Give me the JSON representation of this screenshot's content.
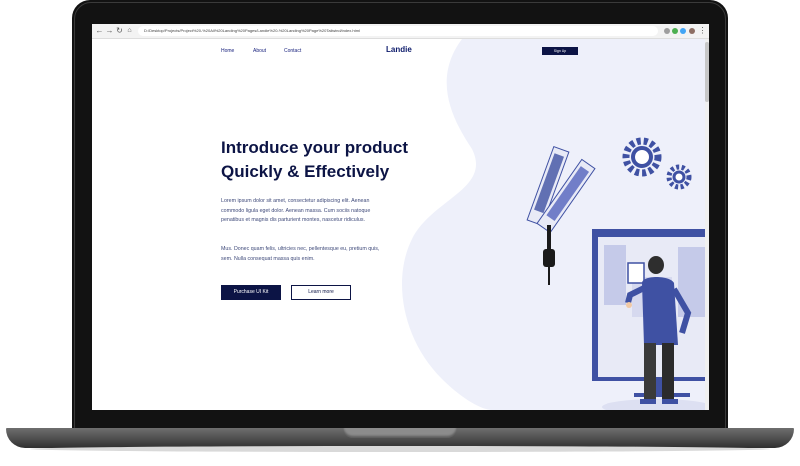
{
  "browser": {
    "url": "D:/Desktop/Projects/Project%20-%20All%20Landing%20Pages/Landie%20-%20Landing%20Page%20Tailwind/index.html"
  },
  "header": {
    "nav_links": [
      "Home",
      "About",
      "Contact"
    ],
    "logo": "Landie",
    "cta_label": "Sign Up"
  },
  "hero": {
    "title_line1": "Introduce your product",
    "title_line2": "Quickly & Effectively",
    "paragraph1": "Lorem ipsum dolor sit amet, consectetur adipiscing elit. Aenean commodo ligula eget dolor. Aenean massa. Cum sociis natoque penatibus et magnis dis parturient montes, nascetur ridiculus.",
    "paragraph2": "Mus. Donec quam felis, ultricies nec, pellentesque eu, pretium quis, sem. Nulla consequat massa quis enim.",
    "primary_button": "Purchase UI Kit",
    "secondary_button": "Learn more"
  },
  "colors": {
    "primary": "#0c1445",
    "accent": "#3f51a3",
    "blob": "#eef0fa"
  }
}
